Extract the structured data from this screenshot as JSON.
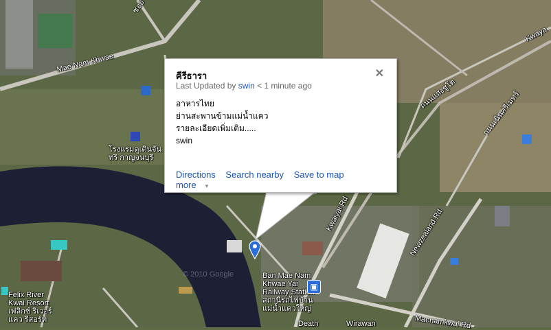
{
  "map_labels": {
    "road_mae_nam_khwae": "Mae Nam Khwae",
    "road_kwaiyai": "Kwaiyai Rd",
    "road_kwaya_top": "Kwaya",
    "road_newzealand": "Newzealand Rd",
    "road_maenamkwai": "Maenamkwai Rd",
    "thai_road_1": "ถนนแสงชูโต",
    "thai_road_2": "ถนนเนินศรีเมทร์",
    "thai_top": "ซอย",
    "hotel_thai_1": "โรงแรมดูเดินจัน",
    "hotel_thai_2": "ทริ กาญจนบุรี",
    "felix_1": "Felix River",
    "felix_2": "Kwai Resort",
    "felix_3": "เฟลิกซ์ ริเวอร์",
    "felix_4": "แคว รีสอร์ท",
    "station_1": "Ban Mae Nam",
    "station_2": "Khwae Yai",
    "station_3": "Railway Station",
    "station_4": "สถานีรถไฟบ้าน",
    "station_5": "แม่น้ำแควใหญ่",
    "death": "Death",
    "wirawan": "Wirawan",
    "copyright": "© 2010 Google"
  },
  "info_window": {
    "title": "คีรีธารา",
    "updated_prefix": "Last Updated by ",
    "updated_user": "swin",
    "updated_suffix": " < 1 minute ago",
    "body_line1": "อาหารไทย",
    "body_line2": "ย่านสะพานข้ามแม่น้ำแคว",
    "body_line3": "รายละเอียดเพิ่มเติม.....",
    "body_line4": "swin",
    "close": "✕",
    "action_directions": "Directions",
    "action_search_nearby": "Search nearby",
    "action_save_to_map": "Save to map",
    "action_more": "more",
    "more_caret": "▾"
  },
  "icons": {
    "pin": "map-marker-icon",
    "train": "train-station-icon"
  },
  "colors": {
    "river": "#1d1f35",
    "vegetation": "#4f5e37",
    "road": "#c9c6bd",
    "pin": "#2a6dd9",
    "link": "#1a56b3"
  }
}
